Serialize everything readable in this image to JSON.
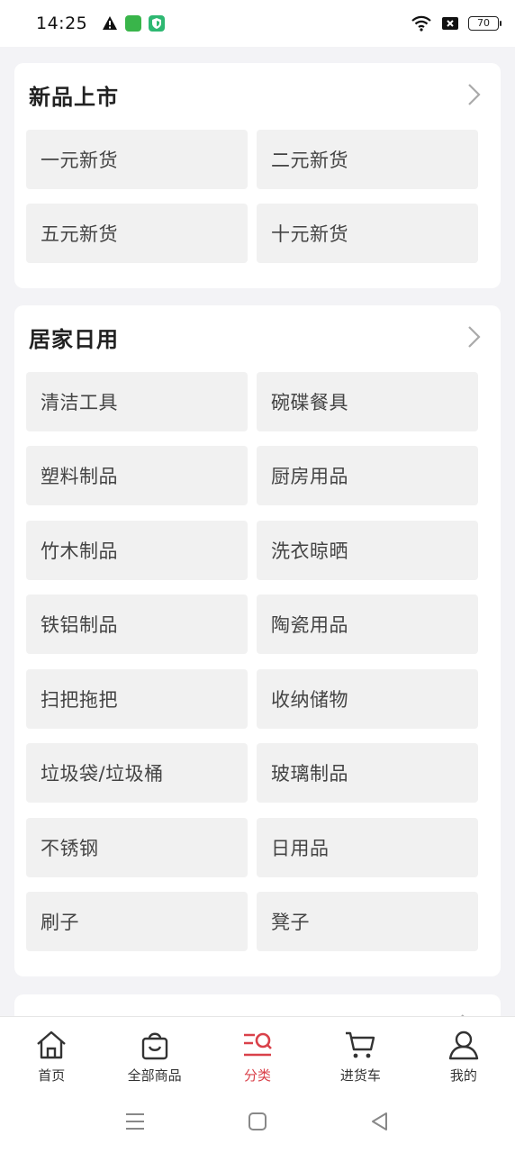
{
  "status_bar": {
    "time": "14:25",
    "battery": "70",
    "icons": [
      "warning-icon",
      "app-icon-green",
      "shield-icon-green",
      "wifi-icon",
      "sim-off-icon"
    ]
  },
  "sections": [
    {
      "title": "新品上市",
      "items": [
        "一元新货",
        "二元新货",
        "五元新货",
        "十元新货"
      ]
    },
    {
      "title": "居家日用",
      "items": [
        "清洁工具",
        "碗碟餐具",
        "塑料制品",
        "厨房用品",
        "竹木制品",
        "洗衣晾晒",
        "铁铝制品",
        "陶瓷用品",
        "扫把拖把",
        "收纳储物",
        "垃圾袋/垃圾桶",
        "玻璃制品",
        "不锈钢",
        "日用品",
        "刷子",
        "凳子"
      ]
    }
  ],
  "tabbar": {
    "tabs": [
      {
        "label": "首页",
        "icon": "home-icon"
      },
      {
        "label": "全部商品",
        "icon": "shopping-bag-icon"
      },
      {
        "label": "分类",
        "icon": "category-search-icon"
      },
      {
        "label": "进货车",
        "icon": "cart-icon"
      },
      {
        "label": "我的",
        "icon": "user-icon"
      }
    ],
    "active_index": 2,
    "active_color": "#d9414a"
  },
  "system_nav": [
    "menu-icon",
    "home-square-icon",
    "back-triangle-icon"
  ]
}
